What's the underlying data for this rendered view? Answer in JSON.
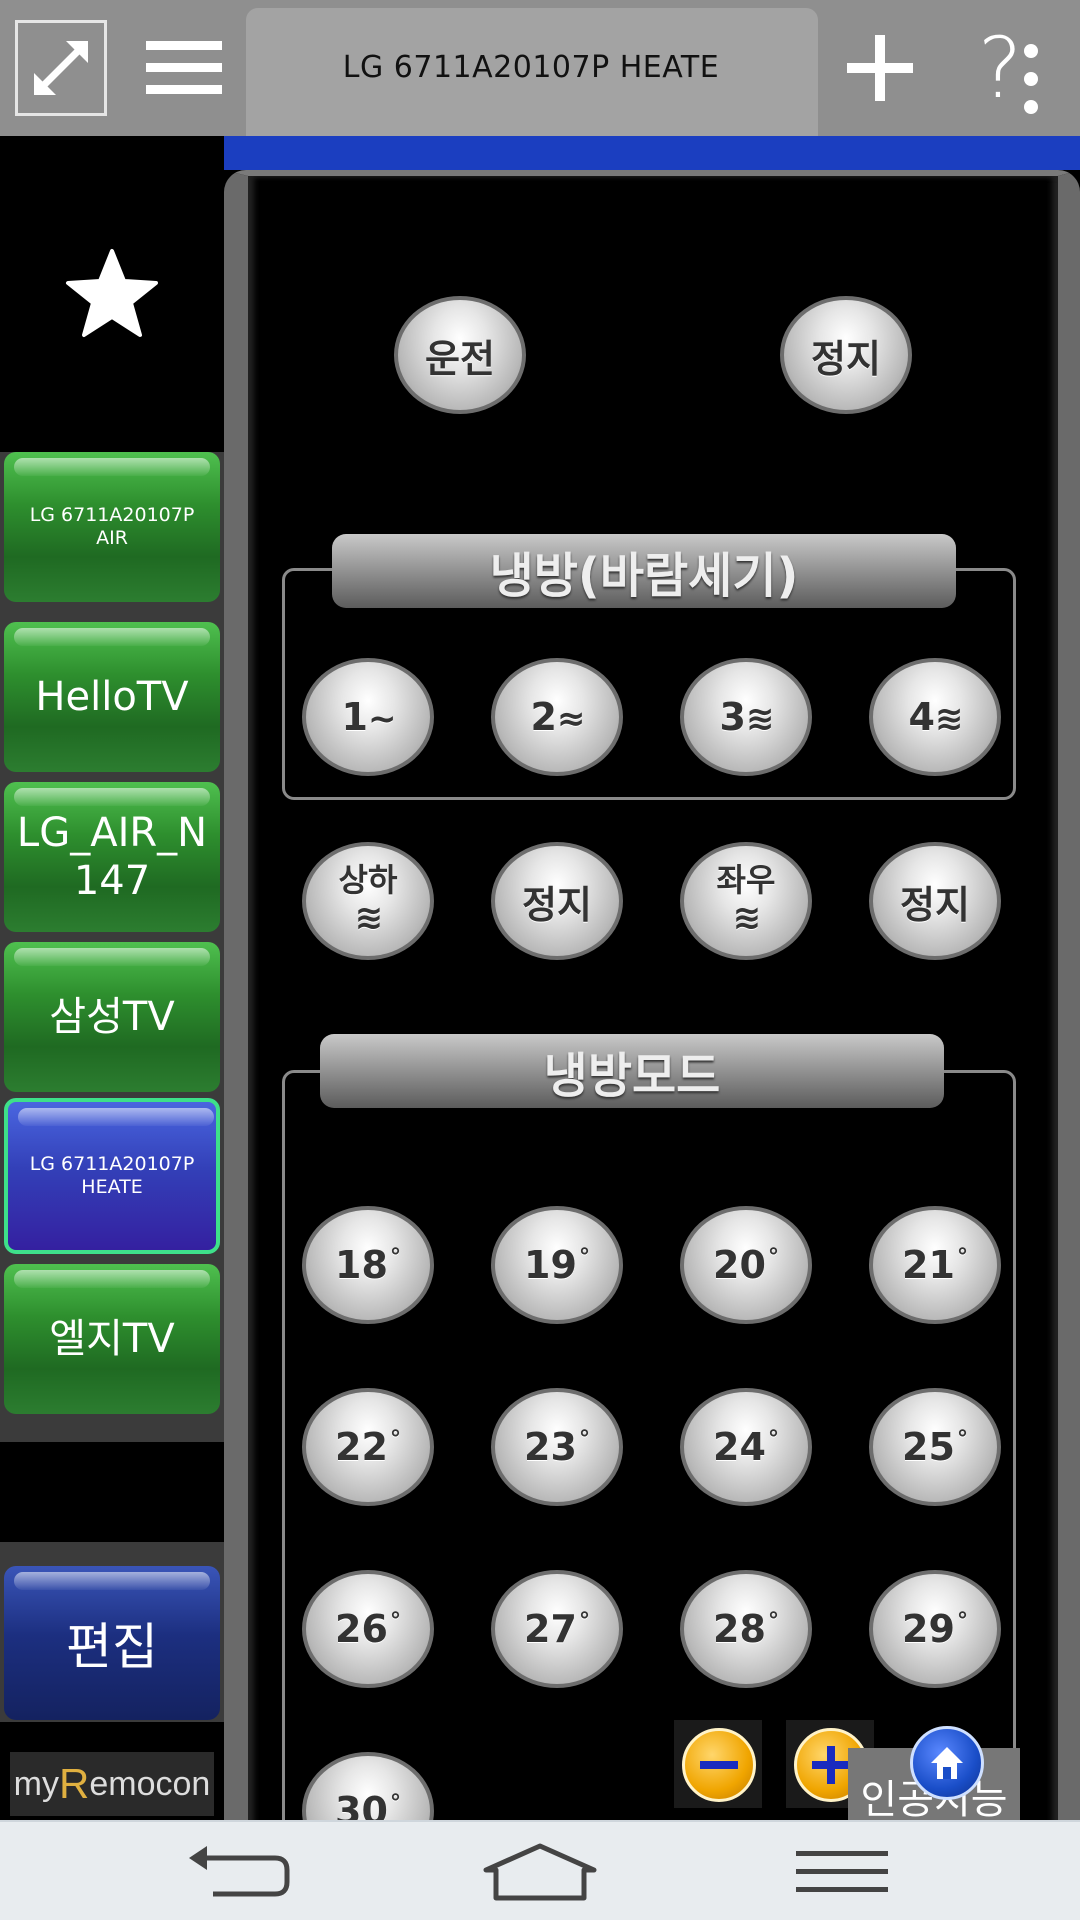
{
  "topbar": {
    "title": "LG 6711A20107P HEATE",
    "help_label": "?"
  },
  "sidebar": {
    "devices": [
      {
        "label": "LG 6711A20107P AIR",
        "size": "small",
        "active": false
      },
      {
        "label": "HelloTV",
        "size": "big",
        "active": false
      },
      {
        "label": "LG_AIR_N147",
        "size": "big",
        "active": false
      },
      {
        "label": "삼성TV",
        "size": "big",
        "active": false
      },
      {
        "label": "LG 6711A20107P HEATE",
        "size": "small",
        "active": true
      },
      {
        "label": "엘지TV",
        "size": "big",
        "active": false
      }
    ],
    "edit_label": "편집",
    "logo_prefix": "my",
    "logo_r": "R",
    "logo_suffix": "emocon"
  },
  "remote": {
    "power_on": "운전",
    "power_off": "정지",
    "wind_group_title": "냉방(바람세기)",
    "wind_buttons": [
      "1",
      "2",
      "3",
      "4"
    ],
    "wind_wave_1": "~",
    "wind_wave_2": "≈",
    "wind_wave_3": "≋",
    "wind_wave_4": "≋",
    "swing_updown": "상하",
    "swing_updown_stop": "정지",
    "swing_leftright": "좌우",
    "swing_leftright_stop": "정지",
    "swing_wave": "≋",
    "mode_group_title": "냉방모드",
    "temps": [
      "18",
      "19",
      "20",
      "21",
      "22",
      "23",
      "24",
      "25",
      "26",
      "27",
      "28",
      "29",
      "30"
    ],
    "degree_symbol": "°",
    "auto_label": "인공지능"
  },
  "colors": {
    "accent_blue": "#1b3ec0",
    "active_border": "#3ee08a",
    "device_green": "#2e8f2e",
    "edit_blue": "#1c2f80"
  }
}
